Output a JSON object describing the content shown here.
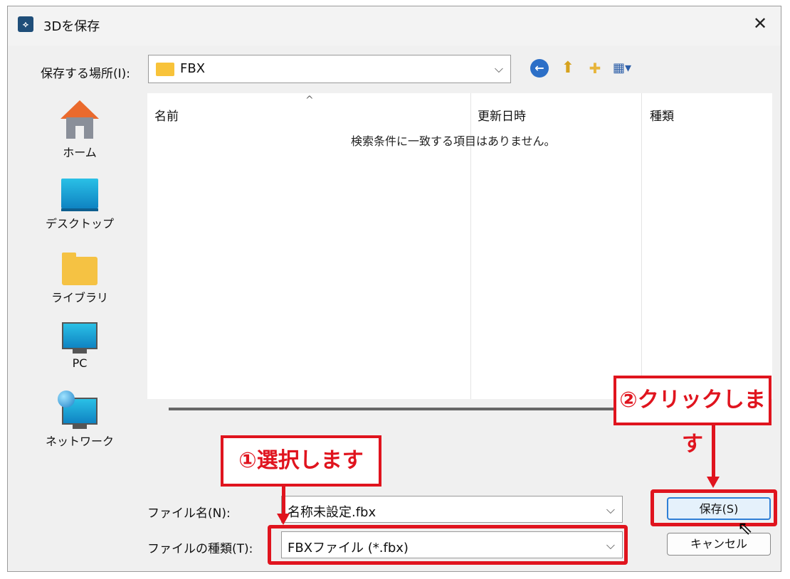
{
  "window": {
    "title": "3Dを保存",
    "close_glyph": "✕"
  },
  "location": {
    "label": "保存する場所(I):",
    "value": "FBX"
  },
  "sidebar": {
    "items": [
      {
        "label": "ホーム",
        "icon": "home-icon"
      },
      {
        "label": "デスクトップ",
        "icon": "desktop-icon"
      },
      {
        "label": "ライブラリ",
        "icon": "library-icon"
      },
      {
        "label": "PC",
        "icon": "pc-icon"
      },
      {
        "label": "ネットワーク",
        "icon": "network-icon"
      }
    ]
  },
  "filelist": {
    "columns": [
      "名前",
      "更新日時",
      "種類"
    ],
    "empty_message": "検索条件に一致する項目はありません。"
  },
  "filename": {
    "label": "ファイル名(N):",
    "value": "名称未設定.fbx"
  },
  "filetype": {
    "label": "ファイルの種類(T):",
    "value": "FBXファイル (*.fbx)"
  },
  "buttons": {
    "save": "保存(S)",
    "cancel": "キャンセル"
  },
  "annotations": {
    "step1": "①選択します",
    "step2": "②クリックします",
    "color": "#e0141e"
  }
}
